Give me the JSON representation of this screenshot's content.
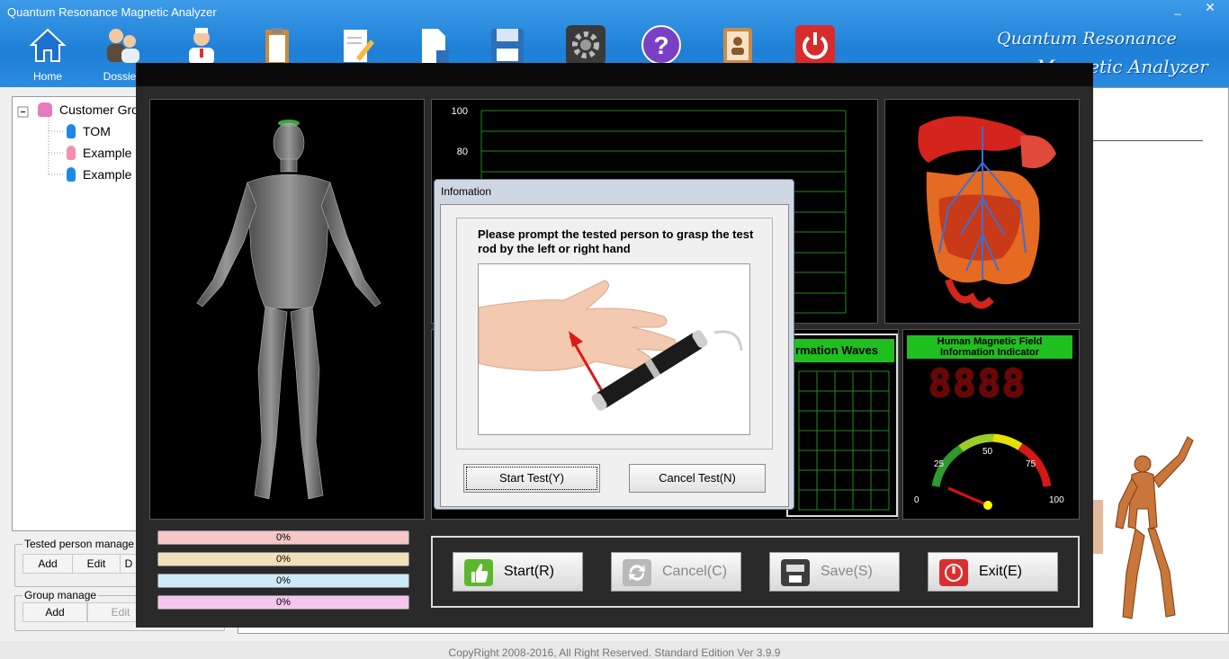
{
  "app": {
    "title": "Quantum Resonance Magnetic Analyzer",
    "brand_line1": "Quantum Resonance",
    "brand_line2": "Magnetic Analyzer",
    "minimize": "_",
    "close": "✕"
  },
  "toolbar": {
    "items": [
      {
        "label": "Home",
        "icon": "home-icon"
      },
      {
        "label": "Dossier",
        "icon": "dossier-icon"
      },
      {
        "label": "",
        "icon": "doctor-icon"
      },
      {
        "label": "",
        "icon": "clipboard-icon"
      },
      {
        "label": "",
        "icon": "edit-report-icon"
      },
      {
        "label": "",
        "icon": "document-icon"
      },
      {
        "label": "",
        "icon": "save-disk-icon"
      },
      {
        "label": "",
        "icon": "settings-gear-icon"
      },
      {
        "label": "",
        "icon": "help-icon"
      },
      {
        "label": "",
        "icon": "contact-book-icon"
      },
      {
        "label": "",
        "icon": "power-icon"
      }
    ]
  },
  "tree": {
    "group": "Customer Gro",
    "customers": [
      {
        "name": "TOM",
        "color": "#1e88e5"
      },
      {
        "name": "Example",
        "color": "#f48fb1"
      },
      {
        "name": "Example",
        "color": "#1e88e5"
      }
    ]
  },
  "tested_person_manage": {
    "title": "Tested person manage",
    "add": "Add",
    "edit": "Edit",
    "delete": "D"
  },
  "group_manage": {
    "title": "Group manage",
    "add": "Add",
    "edit": "Edit"
  },
  "status_bar": "CopyRight 2008-2016, All Right Reserved.  Standard Edition Ver 3.9.9",
  "test_window": {
    "chart_ticks": [
      "100",
      "80"
    ],
    "progress": [
      {
        "label": "0%",
        "value": 0,
        "color": "#f6c7c7"
      },
      {
        "label": "0%",
        "value": 0,
        "color": "#efe0b8"
      },
      {
        "label": "0%",
        "value": 0,
        "color": "#cfeaf7"
      },
      {
        "label": "0%",
        "value": 0,
        "color": "#f4c6ec"
      }
    ],
    "waves_label": "rmation Waves",
    "indicator": {
      "title_line1": "Human Magnetic Field",
      "title_line2": "Information Indicator",
      "digits": "8888",
      "gauge_labels": [
        "0",
        "25",
        "50",
        "75",
        "100"
      ]
    },
    "actions": {
      "start": "Start(R)",
      "cancel": "Cancel(C)",
      "save": "Save(S)",
      "exit": "Exit(E)"
    }
  },
  "dialog": {
    "title": "Infomation",
    "message": "Please prompt the tested person to grasp the test rod by the left or right hand",
    "start_test": "Start Test(Y)",
    "cancel_test": "Cancel Test(N)"
  }
}
